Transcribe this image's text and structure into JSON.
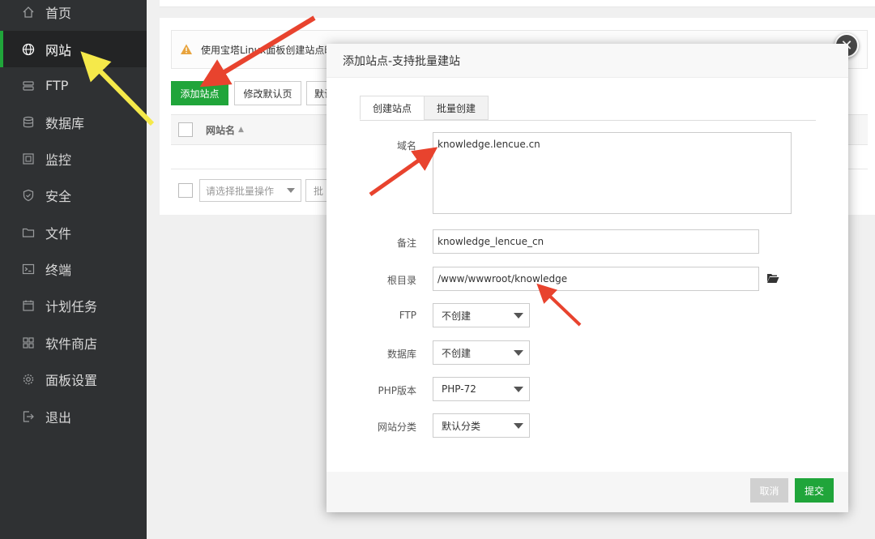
{
  "sidebar": {
    "items": [
      {
        "label": "首页",
        "icon": "home-icon",
        "active": false
      },
      {
        "label": "网站",
        "icon": "globe-icon",
        "active": true
      },
      {
        "label": "FTP",
        "icon": "ftp-icon",
        "active": false
      },
      {
        "label": "数据库",
        "icon": "database-icon",
        "active": false
      },
      {
        "label": "监控",
        "icon": "monitor-icon",
        "active": false
      },
      {
        "label": "安全",
        "icon": "shield-icon",
        "active": false
      },
      {
        "label": "文件",
        "icon": "folder-icon",
        "active": false
      },
      {
        "label": "终端",
        "icon": "terminal-icon",
        "active": false
      },
      {
        "label": "计划任务",
        "icon": "calendar-icon",
        "active": false
      },
      {
        "label": "软件商店",
        "icon": "grid-icon",
        "active": false
      },
      {
        "label": "面板设置",
        "icon": "gear-icon",
        "active": false
      },
      {
        "label": "退出",
        "icon": "logout-icon",
        "active": false
      }
    ]
  },
  "main": {
    "notice_text": "使用宝塔Linux面板创建站点时",
    "add_site_label": "添加站点",
    "modify_default_label": "修改默认页",
    "default_site_label": "默认",
    "column_site_name": "网站名",
    "bulk_placeholder": "请选择批量操作",
    "bulk_button_label": "批"
  },
  "dialog": {
    "title": "添加站点-支持批量建站",
    "tabs": [
      "创建站点",
      "批量创建"
    ],
    "fields": {
      "domain_label": "域名",
      "domain_value": "knowledge.lencue.cn",
      "remark_label": "备注",
      "remark_value": "knowledge_lencue_cn",
      "root_label": "根目录",
      "root_value": "/www/wwwroot/knowledge",
      "ftp_label": "FTP",
      "ftp_value": "不创建",
      "db_label": "数据库",
      "db_value": "不创建",
      "php_label": "PHP版本",
      "php_value": "PHP-72",
      "category_label": "网站分类",
      "category_value": "默认分类"
    },
    "cancel_label": "取消",
    "submit_label": "提交"
  },
  "colors": {
    "accent": "#20a53a",
    "sidebar_bg": "#2f3133",
    "arrow_red": "#e8432e",
    "arrow_yellow": "#f5e94a"
  }
}
